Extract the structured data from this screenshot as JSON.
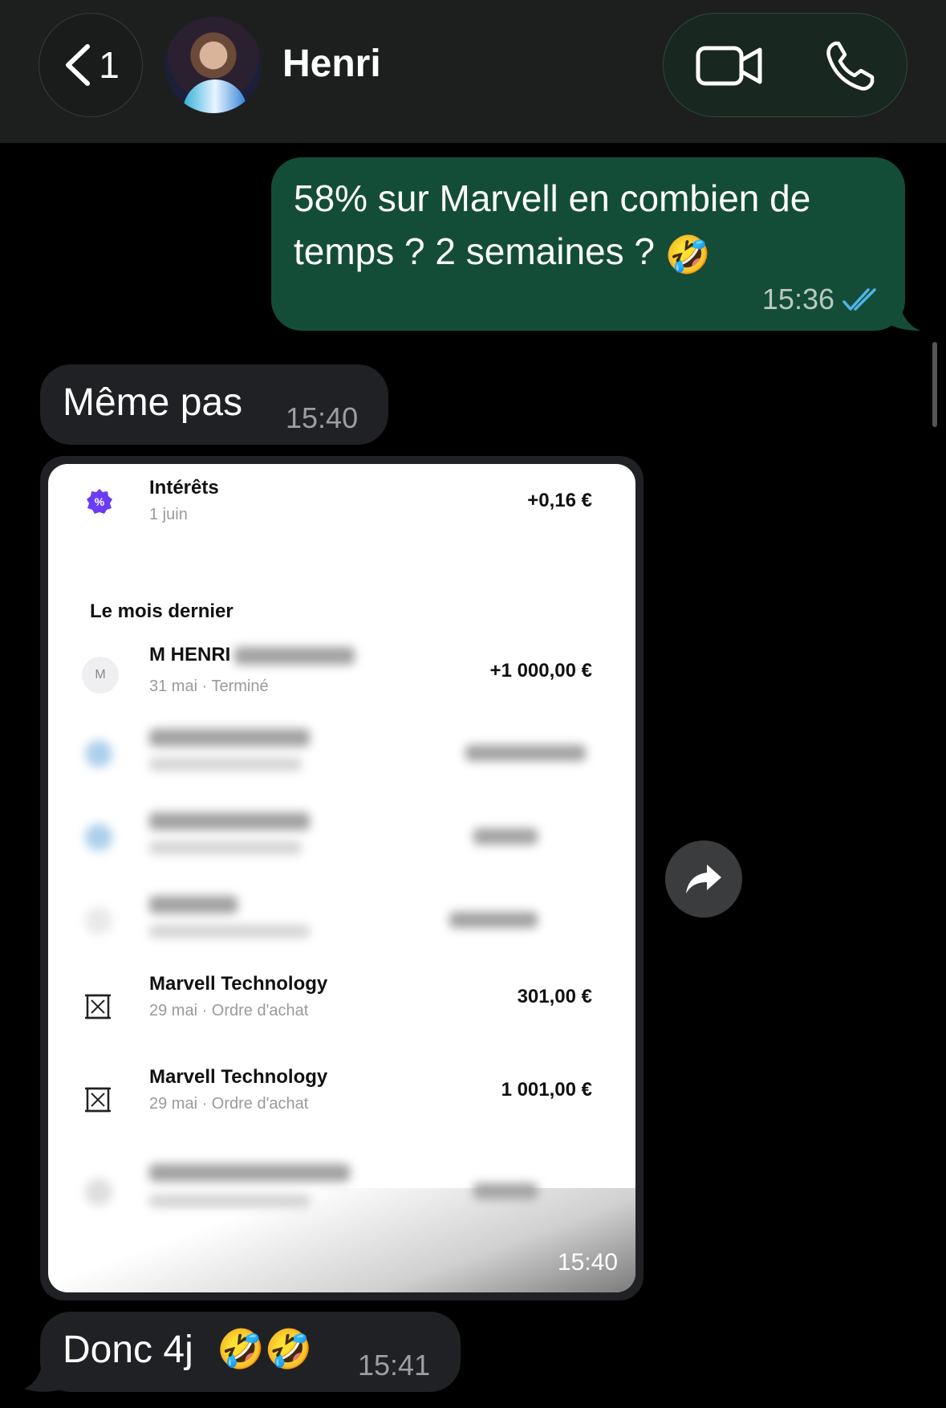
{
  "header": {
    "back_count": "1",
    "contact_name": "Henri"
  },
  "messages": {
    "outgoing_1": {
      "text": "58% sur Marvell en combien de temps ? 2 semaines ?",
      "emoji": "🤣",
      "time": "15:36"
    },
    "incoming_1": {
      "text": "Même pas",
      "time": "15:40"
    },
    "incoming_2": {
      "text": "Donc 4j",
      "emoji": "🤣🤣",
      "time": "15:41"
    }
  },
  "screenshot": {
    "rows": [
      {
        "title": "Intérêts",
        "sub": "1 juin",
        "amount": "+0,16 €"
      },
      {
        "title": "M HENRI",
        "sub": "31 mai · Terminé",
        "amount": "+1 000,00 €"
      },
      {
        "title": "Marvell Technology",
        "sub": "29 mai · Ordre d'achat",
        "amount": "301,00 €"
      },
      {
        "title": "Marvell Technology",
        "sub": "29 mai · Ordre d'achat",
        "amount": "1 001,00 €"
      }
    ],
    "section_title": "Le mois dernier",
    "avatar_letter": "M",
    "overlay_time": "15:40"
  },
  "colors": {
    "outgoing_bubble": "#144d37",
    "incoming_bubble": "#202124",
    "read_ticks": "#4fb3e6",
    "interest_icon": "#6b3cf5"
  },
  "icons": [
    "chevron-left-icon",
    "video-icon",
    "phone-icon",
    "share-icon",
    "percent-badge-icon",
    "stock-icon"
  ]
}
